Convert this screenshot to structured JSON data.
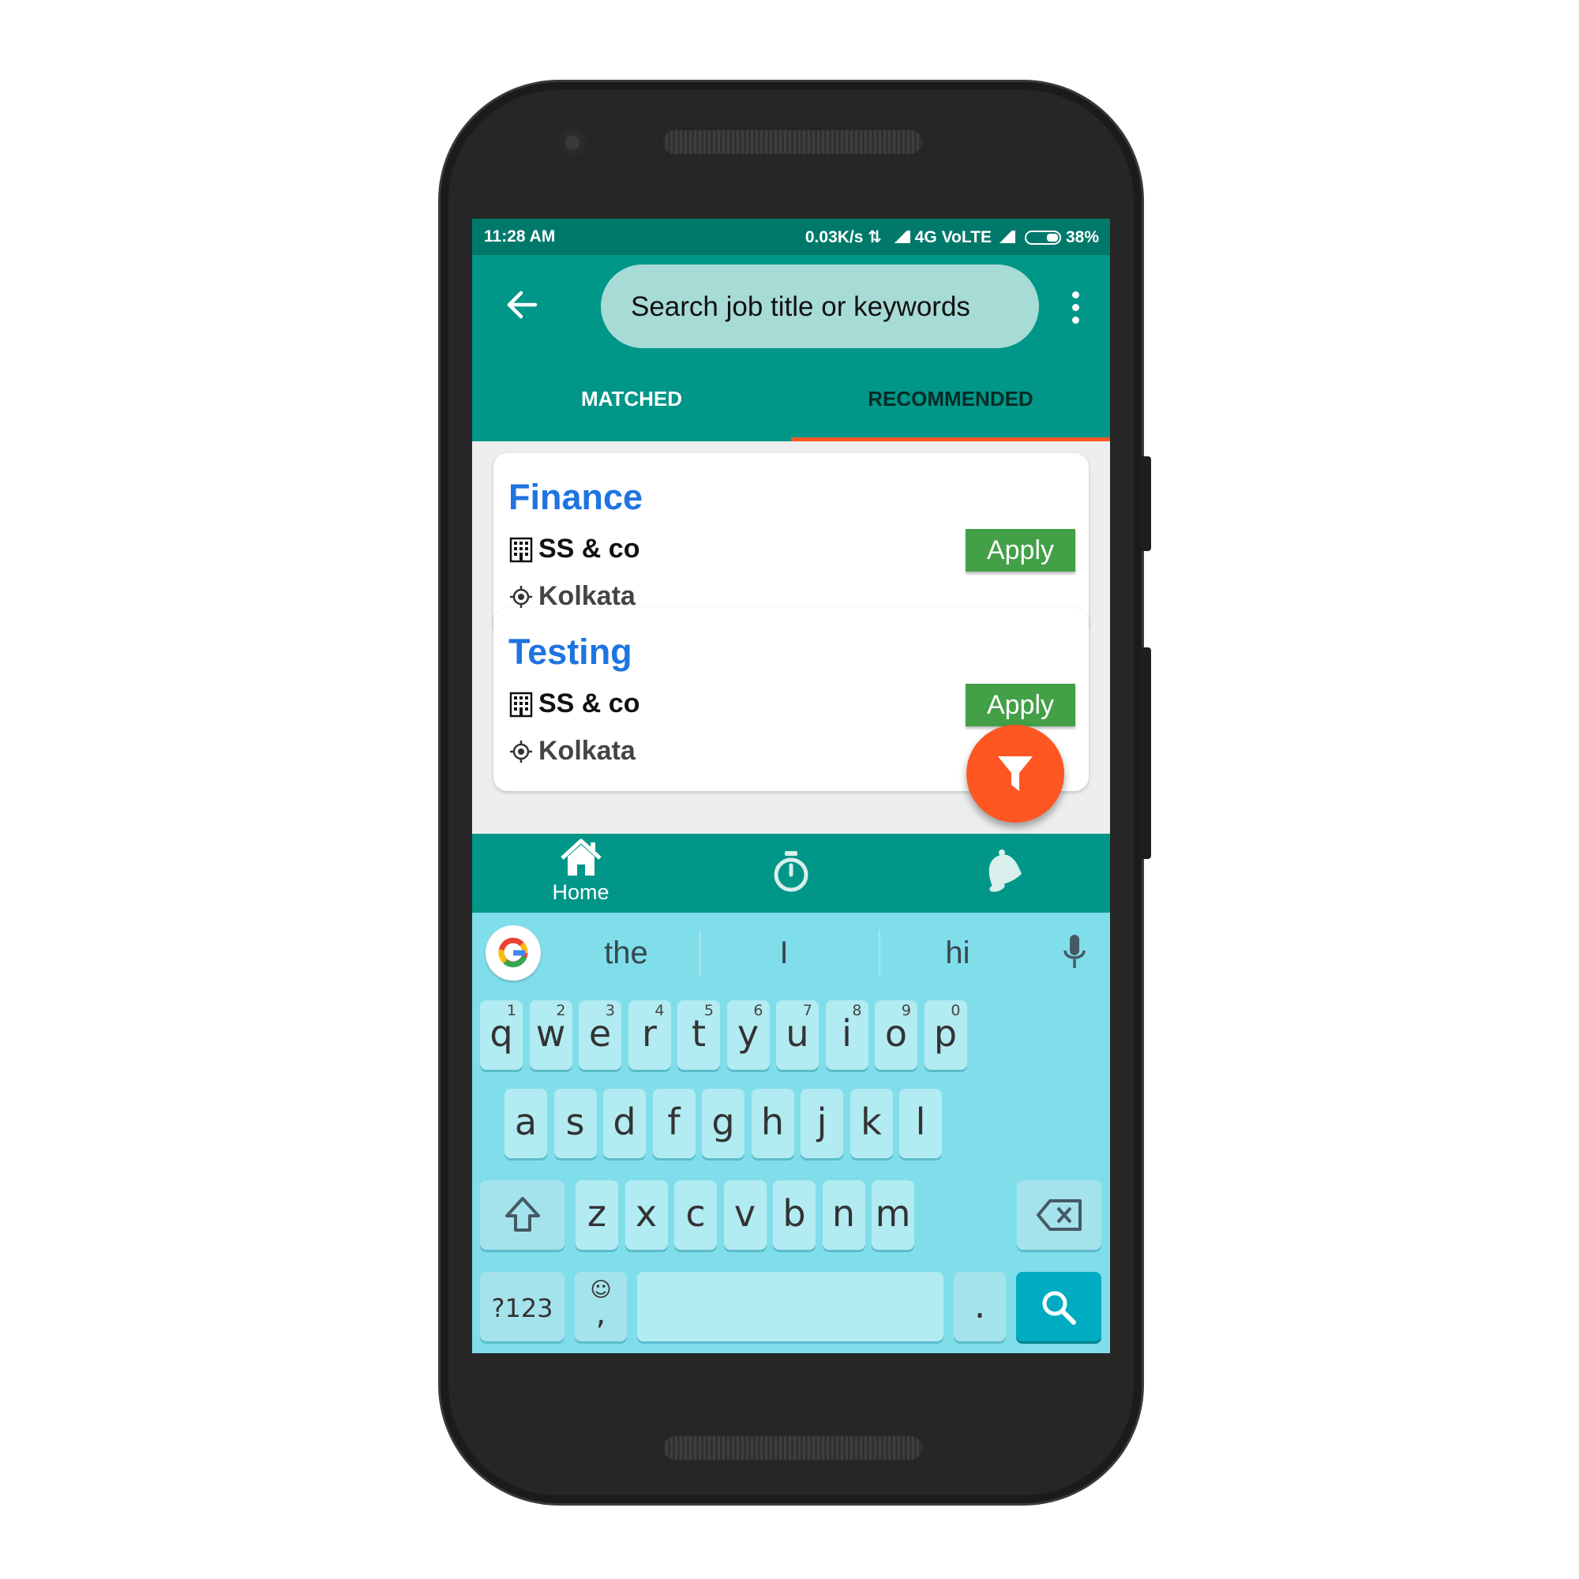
{
  "status_bar": {
    "time": "11:28 AM",
    "network_speed": "0.03K/s",
    "network_type": "4G VoLTE",
    "battery": "38%"
  },
  "toolbar": {
    "back_icon": "arrow-left-icon",
    "search_placeholder": "Search job title or keywords",
    "menu_icon": "more-vertical-icon"
  },
  "tabs": [
    {
      "label": "MATCHED",
      "selected": false
    },
    {
      "label": "RECOMMENDED",
      "selected": true
    }
  ],
  "jobs": [
    {
      "title": "Finance",
      "company": "SS & co",
      "location": "Kolkata",
      "apply_label": "Apply"
    },
    {
      "title": "Testing",
      "company": "SS & co",
      "location": "Kolkata",
      "apply_label": "Apply"
    }
  ],
  "fab": {
    "icon": "filter-icon"
  },
  "bottom_nav": [
    {
      "icon": "home-icon",
      "label": "Home",
      "active": true
    },
    {
      "icon": "stopwatch-icon",
      "label": ""
    },
    {
      "icon": "bell-icon",
      "label": ""
    }
  ],
  "keyboard": {
    "suggestions": [
      "the",
      "I",
      "hi"
    ],
    "row1": [
      {
        "k": "q",
        "s": "1"
      },
      {
        "k": "w",
        "s": "2"
      },
      {
        "k": "e",
        "s": "3"
      },
      {
        "k": "r",
        "s": "4"
      },
      {
        "k": "t",
        "s": "5"
      },
      {
        "k": "y",
        "s": "6"
      },
      {
        "k": "u",
        "s": "7"
      },
      {
        "k": "i",
        "s": "8"
      },
      {
        "k": "o",
        "s": "9"
      },
      {
        "k": "p",
        "s": "0"
      }
    ],
    "row2": [
      "a",
      "s",
      "d",
      "f",
      "g",
      "h",
      "j",
      "k",
      "l"
    ],
    "row3": [
      "z",
      "x",
      "c",
      "v",
      "b",
      "n",
      "m"
    ],
    "symbols_label": "?123",
    "emoji_label": "☺",
    "comma_label": ",",
    "period_label": "."
  },
  "colors": {
    "primary": "#009688",
    "primary_dark": "#00796b",
    "accent": "#ff5722",
    "job_title": "#1e74e0",
    "apply_button": "#43a047",
    "keyboard_bg": "#80deea"
  }
}
